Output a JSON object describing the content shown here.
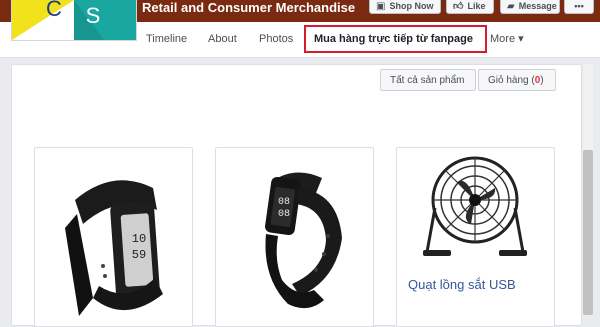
{
  "page": {
    "name": "Retail and Consumer Merchandise",
    "logo_letters": [
      "C",
      "S"
    ]
  },
  "cover_buttons": {
    "shop_now": "Shop Now",
    "like": "Like",
    "message": "Message",
    "more": "•••"
  },
  "nav": {
    "items": [
      "Timeline",
      "About",
      "Photos",
      "Mua hàng trực tiếp từ fanpage",
      "More ▾"
    ],
    "active": "Mua hàng trực tiếp từ fanpage"
  },
  "shop": {
    "all_products": "Tất cả sản phẩm",
    "cart_label": "Giỏ hàng (",
    "cart_count": "0",
    "cart_close": ")"
  },
  "products": [
    {
      "title": "",
      "icon": "smart-band-icon"
    },
    {
      "title": "",
      "icon": "smart-band-icon"
    },
    {
      "title": "Quạt lồng sắt USB",
      "icon": "usb-fan-icon"
    }
  ],
  "watch_faces": {
    "first": [
      "10",
      "59"
    ],
    "second": [
      "08",
      "08"
    ]
  },
  "colors": {
    "cover": "#7a2a10",
    "highlight": "#d41e2c",
    "link": "#365899",
    "logo_yellow": "#f2e21b",
    "logo_teal": "#1aa7a0"
  }
}
